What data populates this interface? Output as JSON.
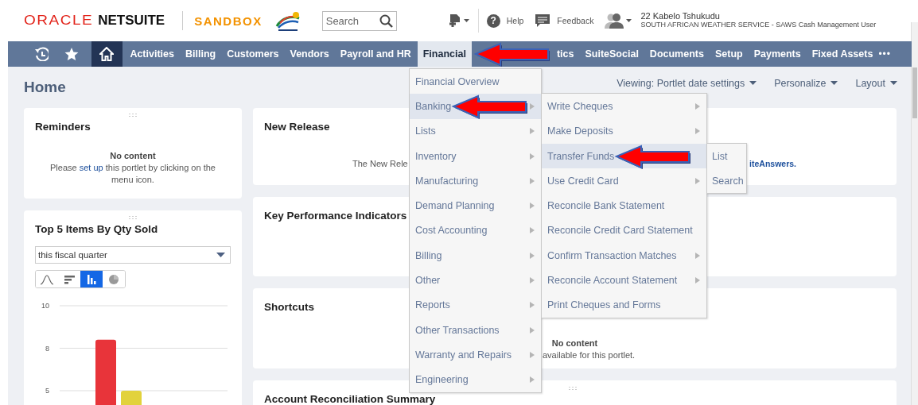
{
  "header": {
    "brand": {
      "maker": "ORACLE",
      "product": "NETSUITE"
    },
    "environment": "SANDBOX",
    "search": {
      "placeholder": "Search"
    },
    "help_icon": "?",
    "help": "Help",
    "feedback": "Feedback",
    "user": {
      "name": "22 Kabelo Tshukudu",
      "role": "SOUTH AFRICAN WEATHER SERVICE - SAWS Cash Management User"
    }
  },
  "nav": [
    {
      "kind": "history",
      "selected": false
    },
    {
      "kind": "star",
      "selected": false
    },
    {
      "kind": "home",
      "selected": true
    },
    {
      "kind": "link",
      "label": "Activities",
      "expanded": false
    },
    {
      "kind": "link",
      "label": "Billing",
      "expanded": false
    },
    {
      "kind": "link",
      "label": "Customers",
      "expanded": false
    },
    {
      "kind": "link",
      "label": "Vendors",
      "expanded": false
    },
    {
      "kind": "link",
      "label": "Payroll and HR",
      "expanded": false
    },
    {
      "kind": "link",
      "label": "Financial",
      "expanded": true,
      "pointed_at": true
    },
    {
      "kind": "link",
      "label": "tics",
      "expanded": false
    },
    {
      "kind": "link",
      "label": "SuiteSocial",
      "expanded": false
    },
    {
      "kind": "link",
      "label": "Documents",
      "expanded": false
    },
    {
      "kind": "link",
      "label": "Setup",
      "expanded": false
    },
    {
      "kind": "link",
      "label": "Payments",
      "expanded": false
    },
    {
      "kind": "link",
      "label": "Fixed Assets",
      "expanded": false
    },
    {
      "kind": "more",
      "label": "•••"
    }
  ],
  "page": {
    "title": "Home",
    "actions": [
      "Viewing: Portlet date settings",
      "Personalize",
      "Layout"
    ]
  },
  "portlets_left": [
    {
      "kind": "message",
      "handle": true,
      "title": "Reminders",
      "heading": "No content",
      "message": {
        "before": "Please",
        "link": "set up",
        "after": "this portlet by clicking on the menu icon."
      }
    },
    {
      "kind": "chart",
      "handle": true,
      "title": "Top 5 Items By Qty Sold",
      "period": "this fiscal quarter",
      "chart_types": [
        {
          "kind": "line",
          "selected": false
        },
        {
          "kind": "hbar",
          "selected": false
        },
        {
          "kind": "column",
          "selected": true
        },
        {
          "kind": "pie",
          "selected": false
        }
      ],
      "chart_data": {
        "type": "bar",
        "values": [
          8,
          5
        ],
        "ylim": [
          5,
          10
        ],
        "yticks": [
          {
            "value": 10,
            "label": "10"
          },
          {
            "value": 7.5,
            "label": "8"
          },
          {
            "value": 5,
            "label": "5"
          }
        ]
      }
    }
  ],
  "portlets_right": [
    {
      "kind": "split",
      "title": "New Release",
      "text_left": "The New Rele",
      "text_right": "iteAnswers."
    },
    {
      "kind": "empty",
      "title": "Key Performance Indicators"
    },
    {
      "kind": "covered_message",
      "title": "Shortcuts",
      "heading": "No content",
      "message": "available for this portlet."
    },
    {
      "kind": "empty",
      "title": "Account Reconciliation Summary",
      "handle": true
    }
  ],
  "menu": [
    {
      "label": "Financial Overview",
      "selected": false,
      "has_submenu": false
    },
    {
      "label": "Banking",
      "selected": true,
      "has_submenu": true,
      "pointed_at": true,
      "children": [
        {
          "label": "Write Cheques",
          "selected": false,
          "has_submenu": true
        },
        {
          "label": "Make Deposits",
          "selected": false,
          "has_submenu": true
        },
        {
          "label": "Transfer Funds",
          "selected": true,
          "has_submenu": false,
          "pointed_at": true,
          "children": [
            {
              "label": "List",
              "selected": false,
              "has_submenu": false
            },
            {
              "label": "Search",
              "selected": false,
              "has_submenu": false
            }
          ]
        },
        {
          "label": "Use Credit Card",
          "selected": false,
          "has_submenu": true
        },
        {
          "label": "Reconcile Bank Statement",
          "selected": false,
          "has_submenu": false
        },
        {
          "label": "Reconcile Credit Card Statement",
          "selected": false,
          "has_submenu": false
        },
        {
          "label": "Confirm Transaction Matches",
          "selected": false,
          "has_submenu": true
        },
        {
          "label": "Reconcile Account Statement",
          "selected": false,
          "has_submenu": true
        },
        {
          "label": "Print Cheques and Forms",
          "selected": false,
          "has_submenu": false
        }
      ]
    },
    {
      "label": "Lists",
      "selected": false,
      "has_submenu": true
    },
    {
      "label": "Inventory",
      "selected": false,
      "has_submenu": true
    },
    {
      "label": "Manufacturing",
      "selected": false,
      "has_submenu": true
    },
    {
      "label": "Demand Planning",
      "selected": false,
      "has_submenu": true
    },
    {
      "label": "Cost Accounting",
      "selected": false,
      "has_submenu": true
    },
    {
      "label": "Billing",
      "selected": false,
      "has_submenu": true
    },
    {
      "label": "Other",
      "selected": false,
      "has_submenu": true
    },
    {
      "label": "Reports",
      "selected": false,
      "has_submenu": true
    },
    {
      "label": "Other Transactions",
      "selected": false,
      "has_submenu": true
    },
    {
      "label": "Warranty and Repairs",
      "selected": false,
      "has_submenu": true
    },
    {
      "label": "Engineering",
      "selected": false,
      "has_submenu": true
    }
  ]
}
